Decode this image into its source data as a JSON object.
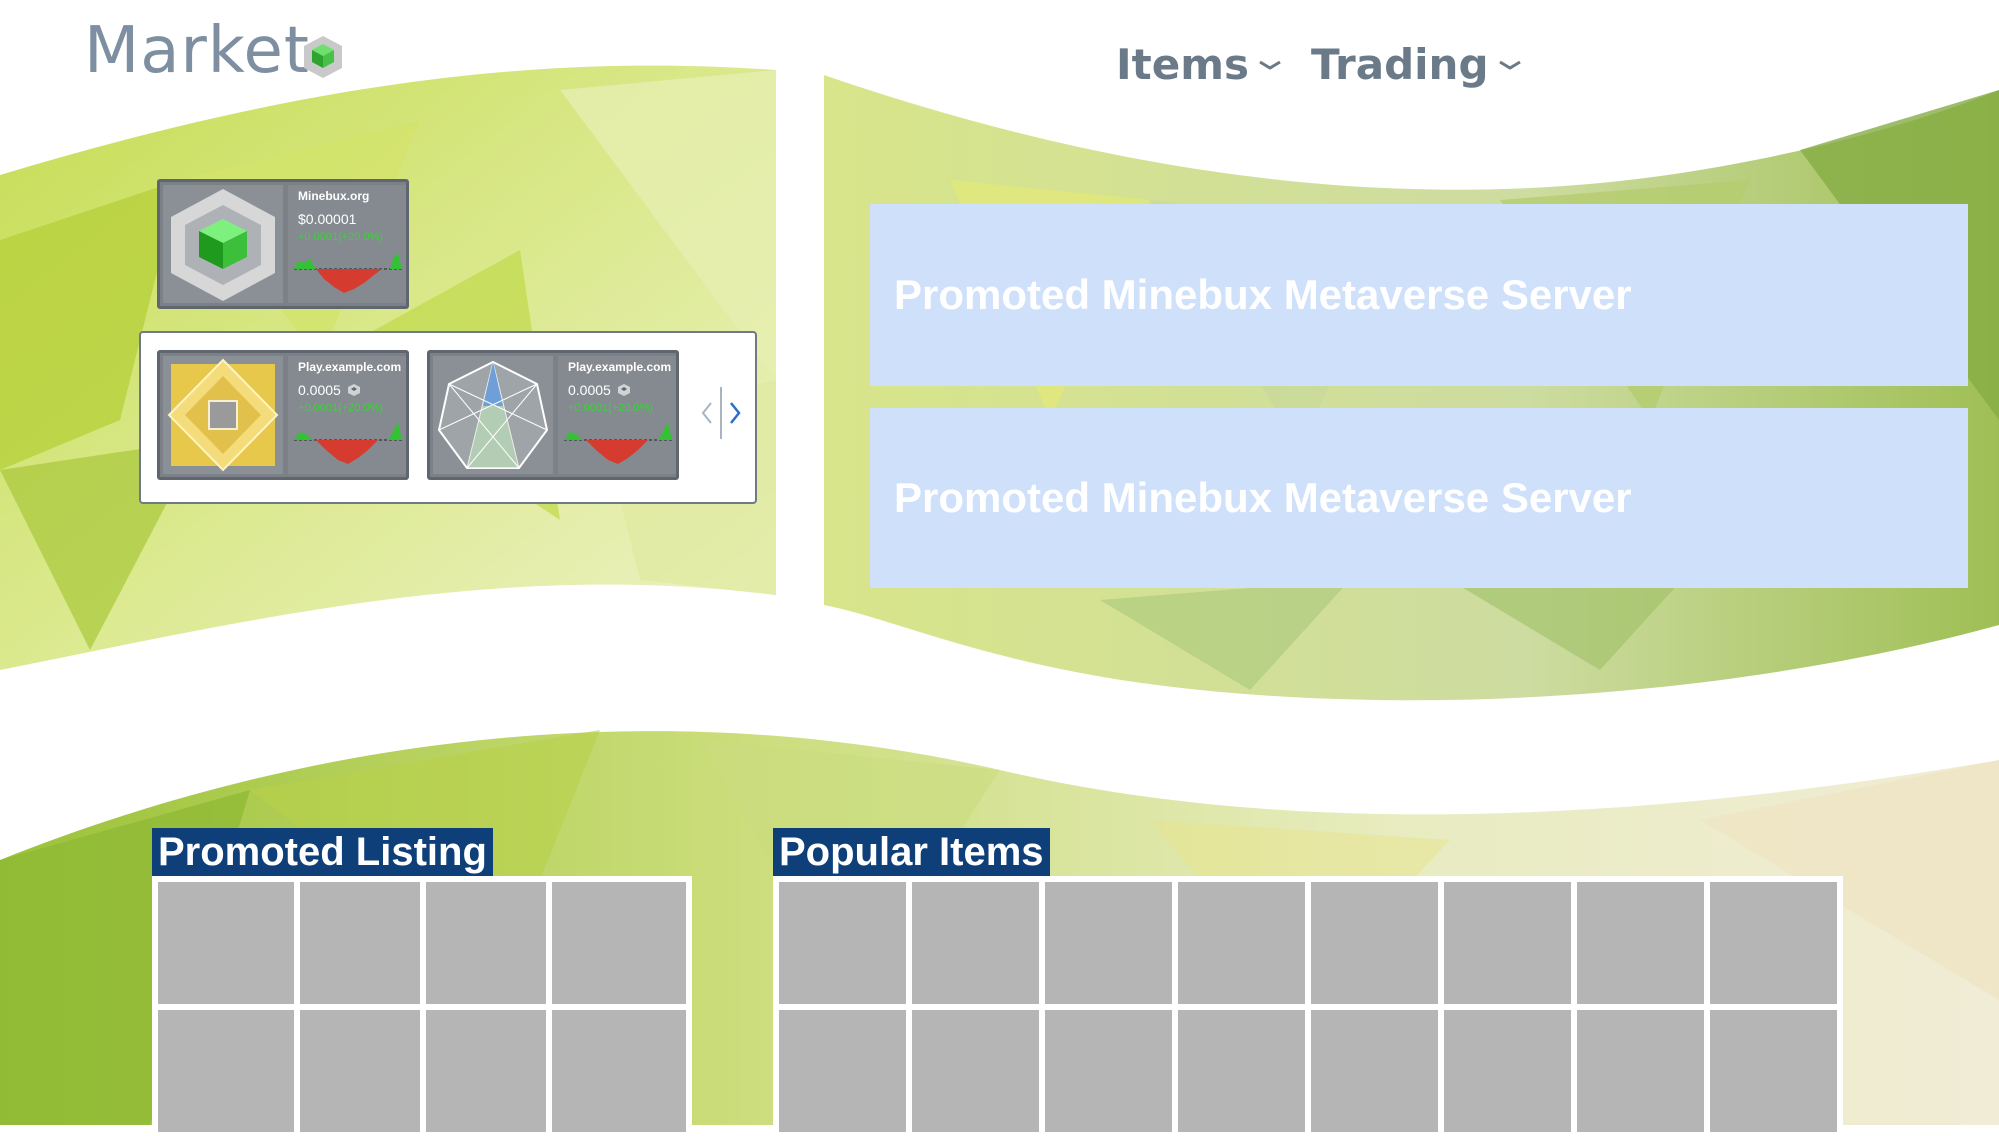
{
  "header": {
    "title": "Market",
    "logo_icon": "green-cube-icon",
    "nav": [
      {
        "label": "Items",
        "icon": "chevron-down-icon"
      },
      {
        "label": "Trading",
        "icon": "chevron-down-icon"
      }
    ]
  },
  "featured_ticker": {
    "site": "Minebux.org",
    "price": "$0.00001",
    "change": "+0.0001(+20.0%)",
    "thumb_icon": "green-cube-icon"
  },
  "carousel": {
    "cards": [
      {
        "site": "Play.example.com",
        "price": "0.0005",
        "change": "+0.0001(+20.0%)",
        "thumb_icon": "gold-diamond-icon"
      },
      {
        "site": "Play.example.com",
        "price": "0.0005",
        "change": "+0.0001(+20.0%)",
        "thumb_icon": "heptagon-icon"
      }
    ],
    "arrows": "carousel-arrows-icon"
  },
  "banners": [
    {
      "label": "Promoted Minebux Metaverse Server"
    },
    {
      "label": "Promoted Minebux Metaverse Server"
    }
  ],
  "promoted_listing": {
    "title": "Promoted Listing",
    "columns": 4,
    "rows": 2
  },
  "popular_items": {
    "title": "Popular Items",
    "columns": 8,
    "rows": 2
  },
  "colors": {
    "accent": "#0e3f78",
    "banner": "#cfe0fb",
    "nav_text": "#6b7a88",
    "positive": "#3bd13b",
    "negative": "#d63b2f"
  }
}
